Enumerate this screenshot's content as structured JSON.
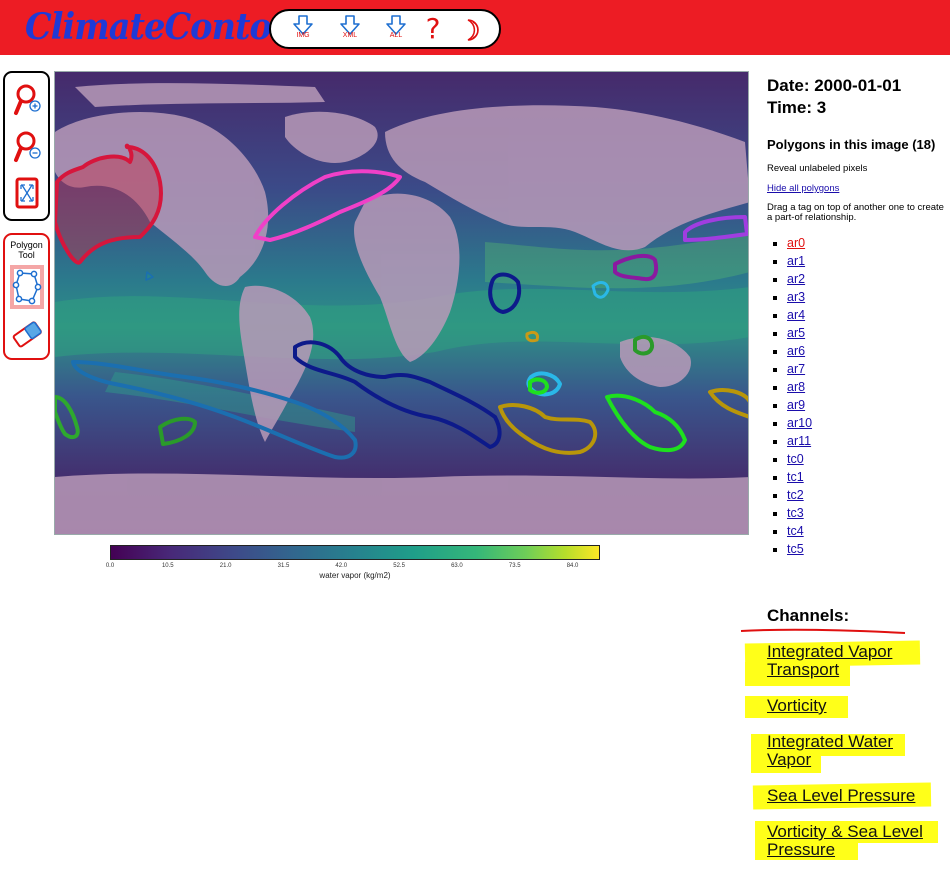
{
  "app": {
    "title": "ClimateContours"
  },
  "toolbar": {
    "img_label": "IMG",
    "xml_label": "XML",
    "all_label": "ALL",
    "help_label": "?"
  },
  "image_info": {
    "date": "Date: 2000-01-01",
    "time": "Time: 3"
  },
  "polygons": {
    "heading": "Polygons in this image (18)",
    "reveal_label": "Reveal unlabeled pixels",
    "hide_all_label": "Hide all polygons",
    "drag_hint": "Drag a tag on top of another one to create a part-of relationship.",
    "items": [
      "ar0",
      "ar1",
      "ar2",
      "ar3",
      "ar4",
      "ar5",
      "ar6",
      "ar7",
      "ar8",
      "ar9",
      "ar10",
      "ar11",
      "tc0",
      "tc1",
      "tc2",
      "tc3",
      "tc4",
      "tc5"
    ],
    "active": "ar0"
  },
  "polygon_tool": {
    "title": "Polygon Tool"
  },
  "colorbar": {
    "label": "water vapor (kg/m2)",
    "ticks": [
      "0.0",
      "10.5",
      "21.0",
      "31.5",
      "42.0",
      "52.5",
      "63.0",
      "73.5",
      "84.0"
    ],
    "colormap": "viridis"
  },
  "channels": {
    "heading": "Channels:",
    "items": [
      "Integrated Vapor Transport",
      "Vorticity",
      "Integrated Water Vapor",
      "Sea Level Pressure",
      "Vorticity & Sea Level Pressure"
    ]
  },
  "colors": {
    "topbar": "#ed1c24",
    "brand": "#1f3ad6",
    "highlight": "#ffff19",
    "link": "#1a0dab",
    "active_link": "#e01010"
  }
}
